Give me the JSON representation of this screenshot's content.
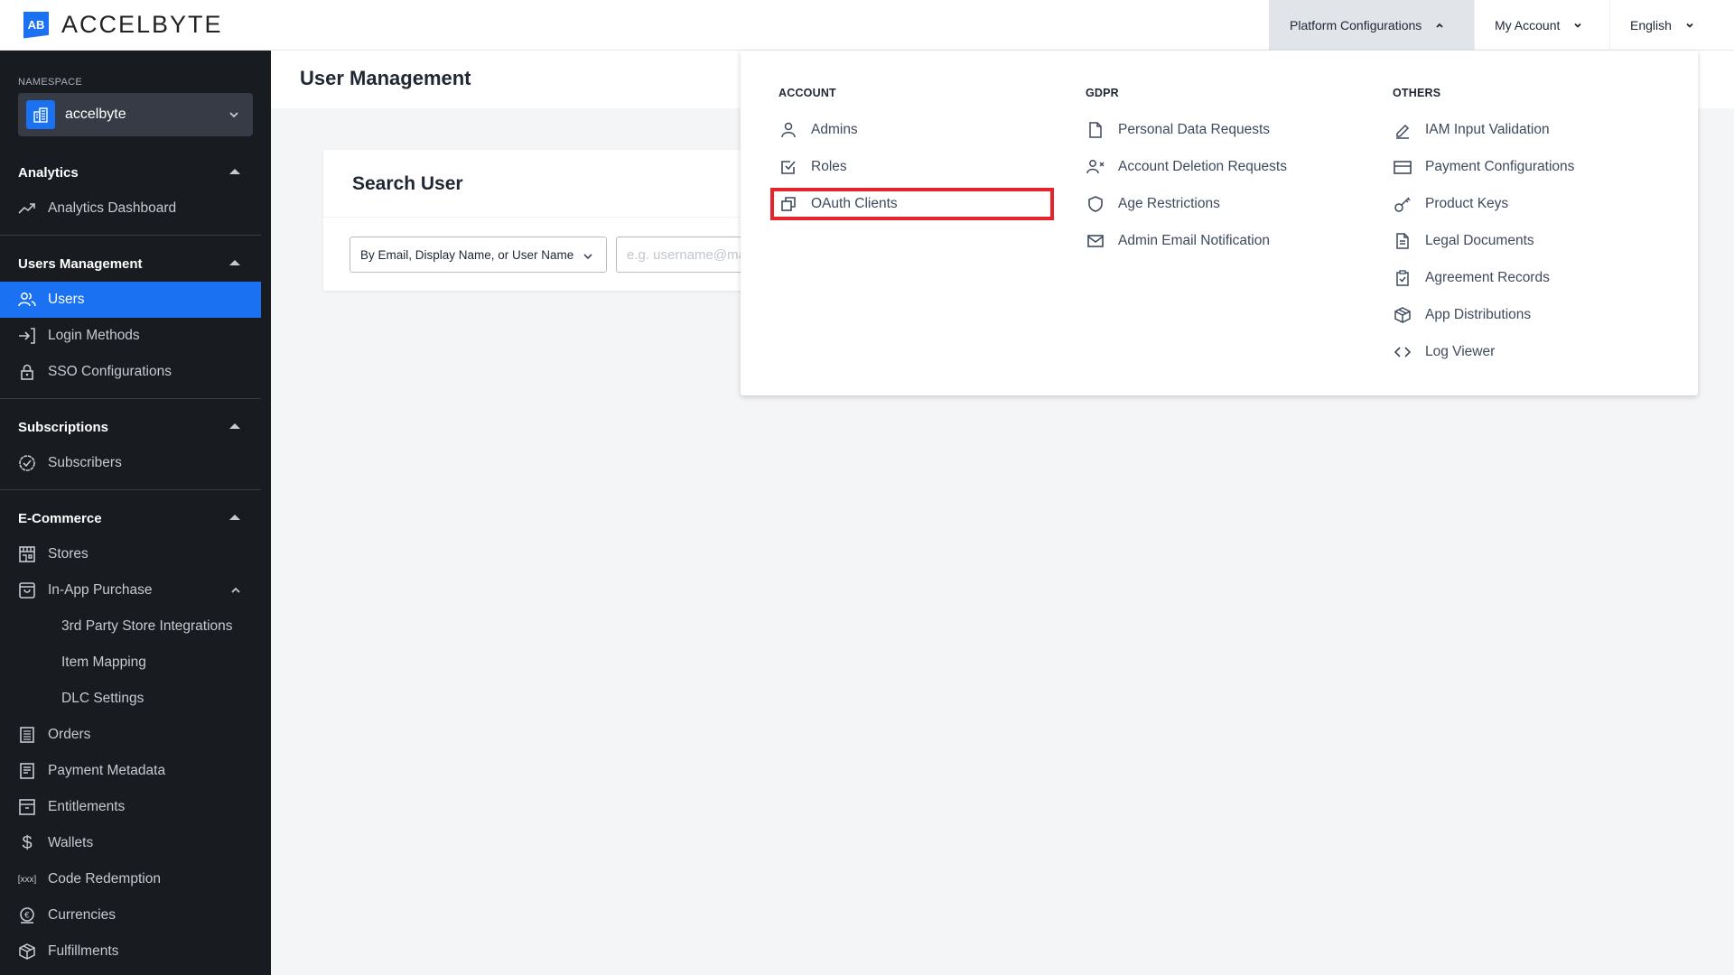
{
  "header": {
    "logo_mark": "AB",
    "logo_text": "ACCELBYTE",
    "nav": [
      {
        "label": "Platform Configurations",
        "state": "expanded"
      },
      {
        "label": "My Account",
        "state": "collapsed"
      },
      {
        "label": "English",
        "state": "collapsed"
      }
    ]
  },
  "sidebar": {
    "namespace_label": "NAMESPACE",
    "namespace_value": "accelbyte",
    "sections": [
      {
        "title": "Analytics",
        "items": [
          {
            "label": "Analytics Dashboard",
            "icon": "trending-up-icon"
          }
        ]
      },
      {
        "title": "Users Management",
        "items": [
          {
            "label": "Users",
            "icon": "users-icon",
            "active": true
          },
          {
            "label": "Login Methods",
            "icon": "login-icon"
          },
          {
            "label": "SSO Configurations",
            "icon": "lock-icon"
          }
        ]
      },
      {
        "title": "Subscriptions",
        "items": [
          {
            "label": "Subscribers",
            "icon": "badge-check-icon"
          }
        ]
      },
      {
        "title": "E-Commerce",
        "items": [
          {
            "label": "Stores",
            "icon": "store-icon"
          },
          {
            "label": "In-App Purchase",
            "icon": "shopping-bag-icon",
            "expanded": true,
            "children": [
              {
                "label": "3rd Party Store Integrations"
              },
              {
                "label": "Item Mapping"
              },
              {
                "label": "DLC Settings"
              }
            ]
          },
          {
            "label": "Orders",
            "icon": "receipt-icon"
          },
          {
            "label": "Payment Metadata",
            "icon": "document-icon"
          },
          {
            "label": "Entitlements",
            "icon": "archive-icon"
          },
          {
            "label": "Wallets",
            "icon": "dollar-icon"
          },
          {
            "label": "Code Redemption",
            "icon": "code-redemption-icon"
          },
          {
            "label": "Currencies",
            "icon": "currency-icon"
          },
          {
            "label": "Fulfillments",
            "icon": "package-icon"
          }
        ]
      }
    ]
  },
  "main": {
    "page_title": "User Management",
    "search_card": {
      "title": "Search User",
      "filter_selected": "By Email, Display Name, or User Name",
      "search_placeholder": "e.g. username@mail.com",
      "search_value": ""
    }
  },
  "dropdown": {
    "columns": [
      {
        "title": "ACCOUNT",
        "items": [
          {
            "label": "Admins",
            "icon": "user-icon"
          },
          {
            "label": "Roles",
            "icon": "checkbox-icon"
          },
          {
            "label": "OAuth Clients",
            "icon": "copy-icon",
            "highlighted": true
          }
        ]
      },
      {
        "title": "GDPR",
        "items": [
          {
            "label": "Personal Data Requests",
            "icon": "file-icon"
          },
          {
            "label": "Account Deletion Requests",
            "icon": "user-remove-icon"
          },
          {
            "label": "Age Restrictions",
            "icon": "shield-icon"
          },
          {
            "label": "Admin Email Notification",
            "icon": "mail-icon"
          }
        ]
      },
      {
        "title": "OTHERS",
        "items": [
          {
            "label": "IAM Input Validation",
            "icon": "pencil-icon"
          },
          {
            "label": "Payment Configurations",
            "icon": "credit-card-icon"
          },
          {
            "label": "Product Keys",
            "icon": "key-icon"
          },
          {
            "label": "Legal Documents",
            "icon": "file-text-icon"
          },
          {
            "label": "Agreement Records",
            "icon": "clipboard-check-icon"
          },
          {
            "label": "App Distributions",
            "icon": "box-icon"
          },
          {
            "label": "Log Viewer",
            "icon": "code-icon"
          }
        ]
      }
    ]
  },
  "colors": {
    "accent": "#1a72f2",
    "sidebar_bg": "#181b20",
    "highlight": "#e5252b"
  }
}
